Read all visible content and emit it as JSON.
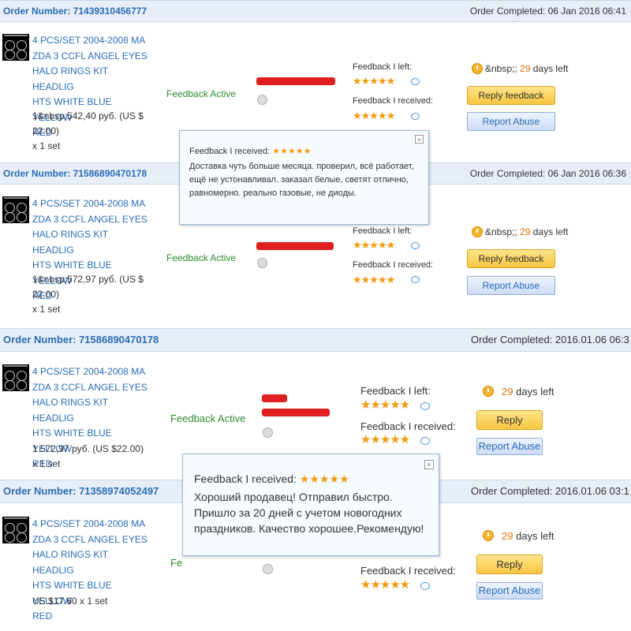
{
  "orders": [
    {
      "order_number": "Order Number: 7143931045677​7",
      "completed": "Order Completed: 06 Jan 2016 06:41",
      "title_lines": [
        "4 PCS/SET 2004-2008 MA",
        "ZDA 3 CCFL ANGEL EYES",
        "HALO RINGS KIT HEADLIG",
        "HTS WHITE BLUE YELLOW",
        "RED"
      ],
      "price_lines": [
        "1&nbsp;542,40 руб. (US $",
        "22.00)",
        "x 1 set"
      ],
      "status": "Feedback Active",
      "feedback_left_label": "Feedback I left:",
      "feedback_received_label": "Feedback I received:",
      "left_stars": "★★★★★",
      "received_stars": "★★★★★",
      "days_prefix": "&nbsp;",
      "days_num": "29",
      "days_suffix": "days left",
      "reply_label": "Reply feedback",
      "report_label": "Report Abuse"
    },
    {
      "order_number": "Order Number: 71586890470178",
      "completed": "Order Completed: 06 Jan 2016 06:36",
      "title_lines": [
        "4 PCS/SET 2004-2008 MA",
        "ZDA 3 CCFL ANGEL EYES",
        "HALO RINGS KIT HEADLIG",
        "HTS WHITE BLUE YELLOW",
        "RED"
      ],
      "price_lines": [
        "1&nbsp;572,97 руб. (US $",
        "22.00)",
        "x 1 set"
      ],
      "status": "Feedback Active",
      "feedback_left_label": "Feedback I left:",
      "feedback_received_label": "Feedback I received:",
      "left_stars": "★★★★★",
      "received_stars": "★★★★★",
      "days_prefix": "&nbsp;",
      "days_num": "29",
      "days_suffix": "days left",
      "reply_label": "Reply feedback",
      "report_label": "Report Abuse"
    },
    {
      "order_number": "Order Number: 71586890470178",
      "completed": "Order Completed: 2016.01.06 06:3",
      "title_lines": [
        "4 PCS/SET 2004-2008 MA",
        "ZDA 3 CCFL ANGEL EYES",
        "HALO RINGS KIT HEADLIG",
        "HTS WHITE BLUE YELLOW",
        "RED"
      ],
      "price_lines": [
        "1 572,97 руб. (US $22.00)",
        "x 1 set"
      ],
      "status": "Feedback Active",
      "feedback_left_label": "Feedback I left:",
      "feedback_received_label": "Feedback I received:",
      "left_stars": "★★★★★",
      "received_stars": "★★★★★",
      "days_num": "29",
      "days_suffix": "days left",
      "reply_label": "Reply",
      "report_label": "Report Abuse"
    },
    {
      "order_number": "Order Number: 71358974052497",
      "completed": "Order Completed: 2016.01.06 03:1",
      "title_lines": [
        "4 PCS/SET 2004-2008 MA",
        "ZDA 3 CCFL ANGEL EYES",
        "HALO RINGS KIT HEADLIG",
        "HTS WHITE BLUE YELLOW",
        "RED"
      ],
      "price_lines": [
        "US $17.60 x 1 set"
      ],
      "status": "Fe",
      "feedback_received_label": "Feedback I received:",
      "received_stars": "★★★★★",
      "days_num": "29",
      "days_suffix": "days left",
      "reply_label": "Reply",
      "report_label": "Report Abuse"
    }
  ],
  "popup_small": {
    "title": "Feedback I received:",
    "stars": "★★★★★",
    "body": "Доставка чуть больше месяца. проверил, всё работает, ещё не устонавливал. заказал белые, светят отлично, равномерно. реально газовые, не диоды.",
    "close": "×"
  },
  "popup_big": {
    "title": "Feedback I received:",
    "stars": "★★★★★",
    "body": "Хороший продавец! Отправил быстро. Пришло за 20 дней с учетом новогодних праздников. Качество хорошее.Рекомендую!",
    "close": "×"
  },
  "colors": {
    "link": "#2a6db5",
    "status": "#2e8b2e",
    "stars": "#f29a0e",
    "header_bg": "#e8eef7"
  },
  "icons": [
    "clock-icon",
    "chat-bubble-icon",
    "avatar-icon",
    "close-icon",
    "product-thumbnail"
  ]
}
